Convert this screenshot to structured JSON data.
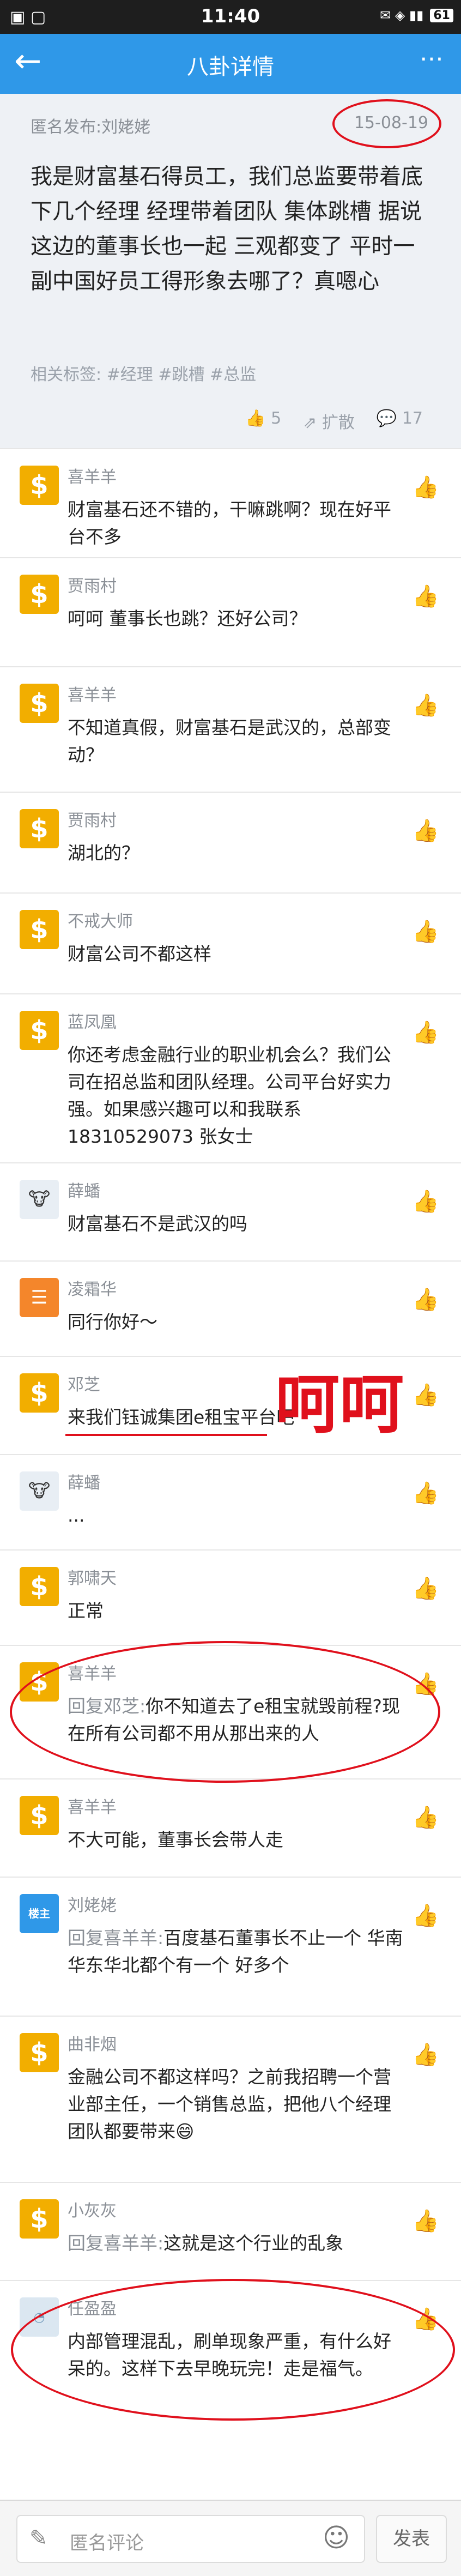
{
  "statusbar": {
    "left_icons": "▣ ▢",
    "time": "11:40",
    "signal": "✉ ◈ ▮▮",
    "battery": "61"
  },
  "navbar": {
    "title": "八卦详情",
    "back_icon": "←",
    "more_icon": "⋯"
  },
  "post": {
    "author": "匿名发布:刘姥姥",
    "date": "15-08-19",
    "body": "我是财富基石得员工，我们总监要带着底下几个经理 经理带着团队 集体跳槽 据说这边的董事长也一起 三观都变了 平时一副中国好员工得形象去哪了？真嗯心",
    "tags": "相关标签: #经理  #跳槽  #总监",
    "like_count": "5",
    "share_label": "扩散",
    "comment_count": "17"
  },
  "comments": [
    {
      "name": "喜羊羊",
      "text": "财富基石还不错的，干嘛跳啊？现在好平台不多"
    },
    {
      "name": "贾雨村",
      "text": "呵呵 董事长也跳？还好公司？"
    },
    {
      "name": "喜羊羊",
      "text": "不知道真假，财富基石是武汉的，总部变动？"
    },
    {
      "name": "贾雨村",
      "text": "湖北的？"
    },
    {
      "name": "不戒大师",
      "text": "财富公司不都这样"
    },
    {
      "name": "蓝凤凰",
      "text": "你还考虑金融行业的职业机会么？我们公司在招总监和团队经理。公司平台好实力强。如果感兴趣可以和我联系18310529073 张女士"
    },
    {
      "name": "薛蟠",
      "text": "财富基石不是武汉的吗"
    },
    {
      "name": "凌霜华",
      "text": "同行你好～"
    },
    {
      "name": "邓芝",
      "text": "来我们钰诚集团e租宝平台吧"
    },
    {
      "name": "薛蟠",
      "text": "..."
    },
    {
      "name": "郭啸天",
      "text": "正常"
    },
    {
      "name": "喜羊羊",
      "reply": "回复邓芝:",
      "text": "你不知道去了e租宝就毁前程?现在所有公司都不用从那出来的人"
    },
    {
      "name": "喜羊羊",
      "text": "不大可能，董事长会带人走"
    },
    {
      "name": "刘姥姥",
      "avatar_text": "楼主",
      "reply": "回复喜羊羊:",
      "text": "百度基石董事长不止一个 华南华东华北都个有一个 好多个"
    },
    {
      "name": "曲非烟",
      "text": "金融公司不都这样吗？之前我招聘一个营业部主任，一个销售总监，把他八个经理团队都要带来😄"
    },
    {
      "name": "小灰灰",
      "reply": "回复喜羊羊:",
      "text": "这就是这个行业的乱象"
    },
    {
      "name": "任盈盈",
      "text": "内部管理混乱，刷单现象严重，有什么好呆的。这样下去早晚玩完！走是福气。"
    }
  ],
  "annotation": "呵呵",
  "bottombar": {
    "placeholder": "匿名评论",
    "send_label": "发表"
  },
  "colors": {
    "nav": "#2f98e8",
    "accent_red": "#e0101c",
    "avatar_gold": "#f2ae00"
  }
}
